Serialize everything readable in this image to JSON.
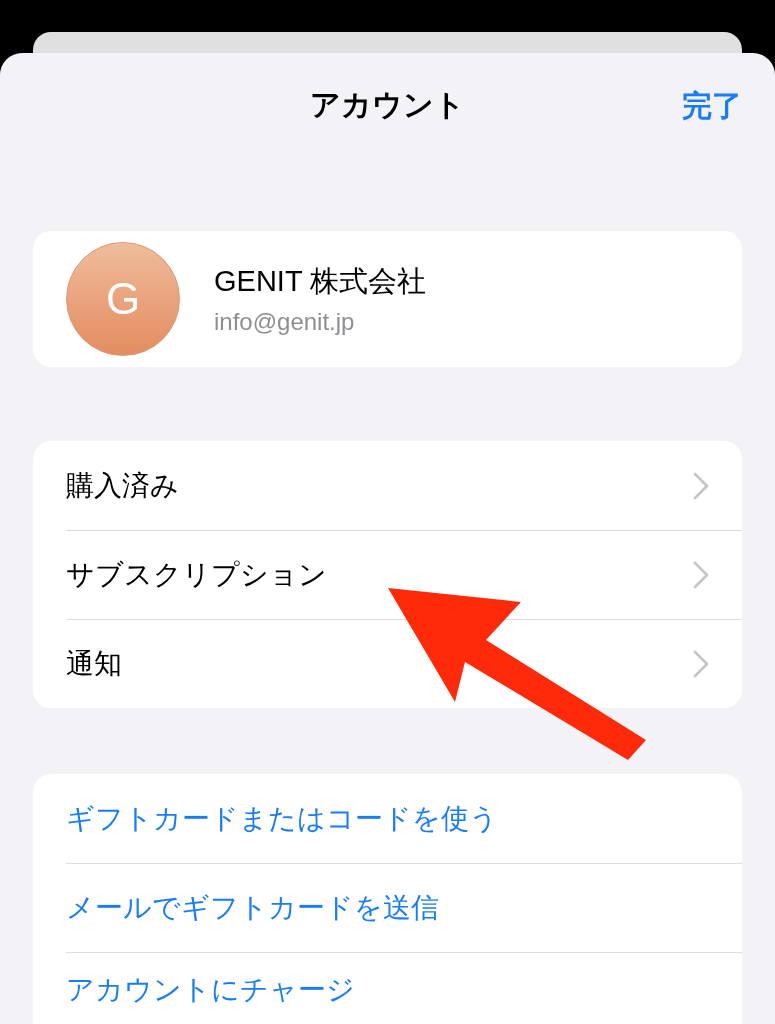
{
  "header": {
    "title": "アカウント",
    "done_button": "完了"
  },
  "profile": {
    "initial": "G",
    "name": "GENIT 株式会社",
    "email": "info@genit.jp"
  },
  "menu_items": [
    {
      "label": "購入済み"
    },
    {
      "label": "サブスクリプション"
    },
    {
      "label": "通知"
    }
  ],
  "action_items": [
    {
      "label": "ギフトカードまたはコードを使う"
    },
    {
      "label": "メールでギフトカードを送信"
    },
    {
      "label": "アカウントにチャージ"
    }
  ]
}
